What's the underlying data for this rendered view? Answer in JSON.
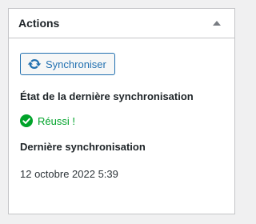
{
  "panel": {
    "title": "Actions"
  },
  "sync_button": {
    "label": "Synchroniser",
    "icon": "sync-icon"
  },
  "last_sync_state": {
    "heading": "État de la dernière synchronisation",
    "status_text": "Réussi !",
    "status_icon": "check-circle-icon"
  },
  "last_sync": {
    "heading": "Dernière synchronisation",
    "value": "12 octobre 2022 5:39"
  },
  "colors": {
    "accent": "#2271b1",
    "success": "#00a32a",
    "border": "#c3c4c7",
    "background": "#f0f0f1"
  }
}
